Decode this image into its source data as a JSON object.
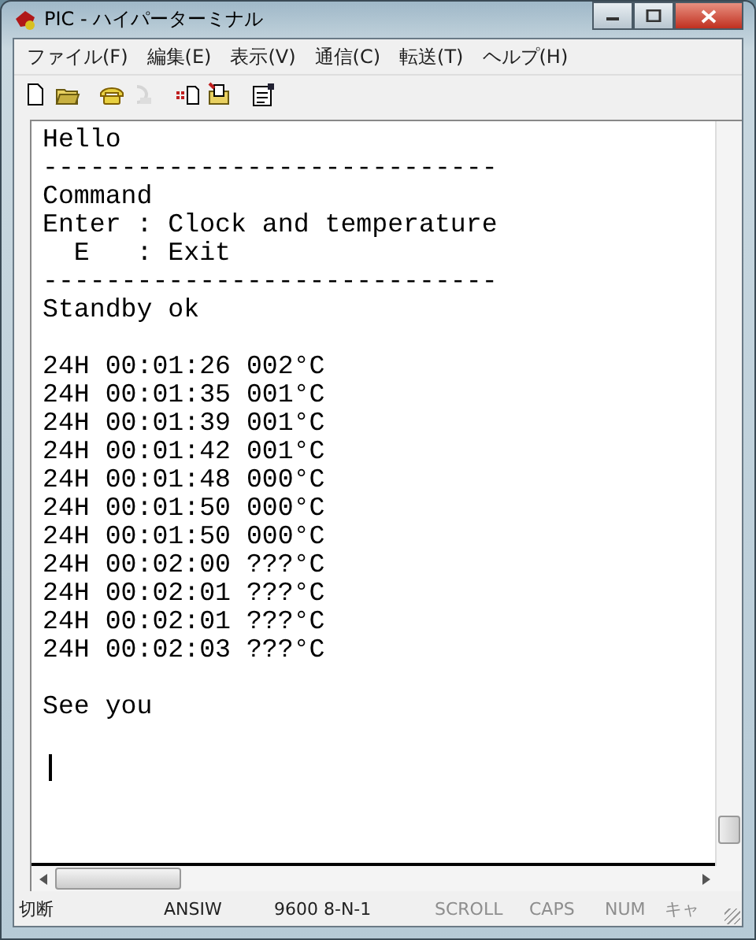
{
  "window": {
    "title": "PIC - ハイパーターミナル"
  },
  "menu": [
    {
      "label": "ファイル(F)"
    },
    {
      "label": "編集(E)"
    },
    {
      "label": "表示(V)"
    },
    {
      "label": "通信(C)"
    },
    {
      "label": "転送(T)"
    },
    {
      "label": "ヘルプ(H)"
    }
  ],
  "toolbar": [
    {
      "kind": "new",
      "disabled": false
    },
    {
      "kind": "open",
      "disabled": false
    },
    {
      "kind": "gap"
    },
    {
      "kind": "call",
      "disabled": false
    },
    {
      "kind": "hangup",
      "disabled": true
    },
    {
      "kind": "gap"
    },
    {
      "kind": "send",
      "disabled": false
    },
    {
      "kind": "receive",
      "disabled": false
    },
    {
      "kind": "gap"
    },
    {
      "kind": "properties",
      "disabled": false
    }
  ],
  "terminal": {
    "blocks": [
      [
        "Hello",
        "-----------------------------",
        "Command",
        "Enter : Clock and temperature",
        "  E   : Exit",
        "-----------------------------",
        "Standby ok"
      ],
      [
        "24H 00:01:26 002°C",
        "24H 00:01:35 001°C",
        "24H 00:01:39 001°C",
        "24H 00:01:42 001°C",
        "24H 00:01:48 000°C",
        "24H 00:01:50 000°C",
        "24H 00:01:50 000°C",
        "24H 00:02:00 ???°C",
        "24H 00:02:01 ???°C",
        "24H 00:02:01 ???°C",
        "24H 00:02:03 ???°C"
      ],
      [
        "See you"
      ]
    ],
    "cursor_visible": true
  },
  "status_bar": [
    {
      "text": "切断",
      "disabled": false
    },
    {
      "text": "ANSIW",
      "disabled": false
    },
    {
      "text": "9600 8-N-1",
      "disabled": false
    },
    {
      "text": "SCROLL",
      "disabled": true
    },
    {
      "text": "CAPS",
      "disabled": true
    },
    {
      "text": "NUM",
      "disabled": true
    },
    {
      "text": "キャ",
      "disabled": true
    }
  ]
}
